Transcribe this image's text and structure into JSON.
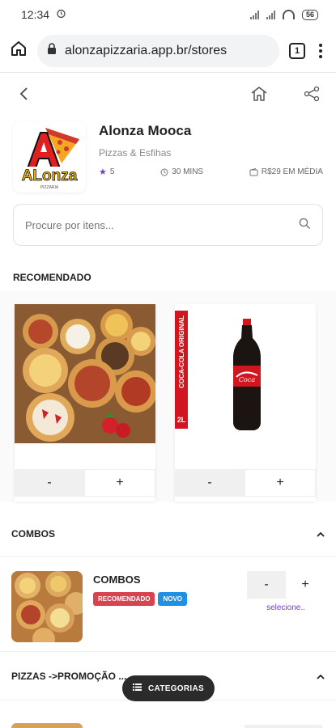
{
  "status": {
    "time": "12:34",
    "battery": "56"
  },
  "browser": {
    "url": "alonzapizzaria.app.br/stores",
    "tabs": "1"
  },
  "store": {
    "name": "Alonza Mooca",
    "category": "Pizzas & Esfihas",
    "rating": "5",
    "time": "30 MINS",
    "avg_price": "R$29 EM MÉDIA",
    "logo_text": "ALonza",
    "logo_sub": "PIZZARIA"
  },
  "search": {
    "placeholder": "Procure por itens..."
  },
  "recommended": {
    "title": "RECOMENDADO",
    "cards": [
      {
        "minus": "-",
        "plus": "+"
      },
      {
        "minus": "-",
        "plus": "+",
        "label": "COCA-COLA ORIGINAL",
        "size": "2L"
      }
    ]
  },
  "categories": [
    {
      "title": "COMBOS",
      "items": [
        {
          "name": "COMBOS",
          "badges": [
            {
              "text": "RECOMENDADO",
              "color": "#d9424f"
            },
            {
              "text": "NOVO",
              "color": "#1e90e6"
            }
          ],
          "minus": "-",
          "plus": "+",
          "select": "selecione.."
        }
      ]
    },
    {
      "title": "PIZZAS ->PROMOÇÃO ..."
    }
  ],
  "fab": {
    "label": "CATEGORIAS"
  },
  "colors": {
    "accent": "#6d3fd0",
    "star": "#6d3fd0"
  }
}
